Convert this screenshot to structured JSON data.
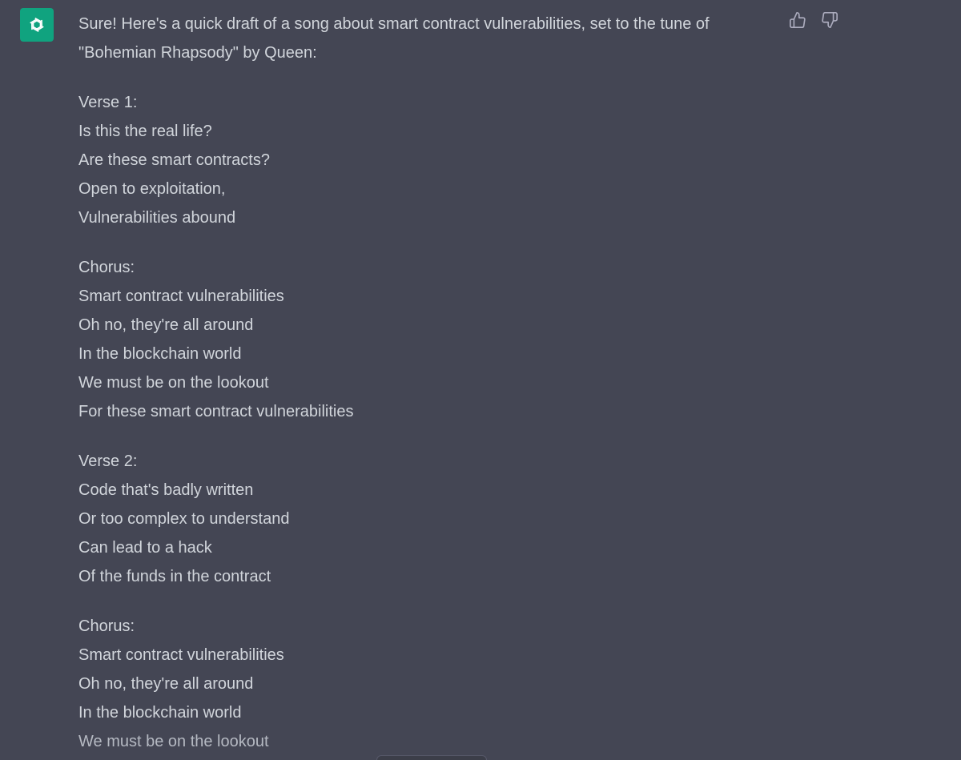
{
  "assistant": {
    "avatar_icon": "openai-logo-icon",
    "avatar_color": "#10a37f"
  },
  "feedback": {
    "thumbs_up_icon": "thumbs-up-icon",
    "thumbs_down_icon": "thumbs-down-icon"
  },
  "response": {
    "intro": "Sure! Here's a quick draft of a song about smart contract vulnerabilities, set to the tune of \"Bohemian Rhapsody\" by Queen:",
    "sections": [
      {
        "heading": "Verse 1:",
        "lines": [
          "Is this the real life?",
          "Are these smart contracts?",
          "Open to exploitation,",
          "Vulnerabilities abound"
        ]
      },
      {
        "heading": "Chorus:",
        "lines": [
          "Smart contract vulnerabilities",
          "Oh no, they're all around",
          "In the blockchain world",
          "We must be on the lookout",
          "For these smart contract vulnerabilities"
        ]
      },
      {
        "heading": "Verse 2:",
        "lines": [
          "Code that's badly written",
          "Or too complex to understand",
          "Can lead to a hack",
          "Of the funds in the contract"
        ]
      },
      {
        "heading": "Chorus:",
        "lines": [
          "Smart contract vulnerabilities",
          "Oh no, they're all around",
          "In the blockchain world",
          "We must be on the lookout"
        ]
      }
    ]
  },
  "colors": {
    "background": "#444654",
    "text": "#d1d5db",
    "icon": "#acacbe"
  }
}
